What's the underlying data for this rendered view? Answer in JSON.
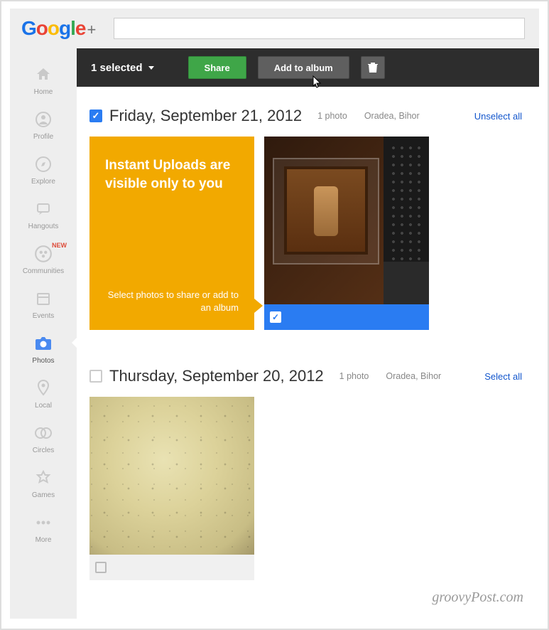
{
  "brand": {
    "name": "Google+",
    "plus": "+"
  },
  "sidebar": {
    "items": [
      {
        "label": "Home"
      },
      {
        "label": "Profile"
      },
      {
        "label": "Explore"
      },
      {
        "label": "Hangouts"
      },
      {
        "label": "Communities",
        "badge": "NEW"
      },
      {
        "label": "Events"
      },
      {
        "label": "Photos"
      },
      {
        "label": "Local"
      },
      {
        "label": "Circles"
      },
      {
        "label": "Games"
      },
      {
        "label": "More"
      }
    ]
  },
  "action_bar": {
    "selected_text": "1 selected",
    "share_label": "Share",
    "add_to_album_label": "Add to album",
    "delete_tooltip": "Delete"
  },
  "groups": [
    {
      "checked": true,
      "title": "Friday, September 21, 2012",
      "count_text": "1 photo",
      "location": "Oradea, Bihor",
      "select_action": "Unselect all",
      "info_tile": {
        "headline": "Instant Uploads are visible only to you",
        "subtext": "Select photos to share or add to an album"
      },
      "photo_selected": true
    },
    {
      "checked": false,
      "title": "Thursday, September 20, 2012",
      "count_text": "1 photo",
      "location": "Oradea, Bihor",
      "select_action": "Select all",
      "photo_selected": false
    }
  ],
  "watermark": "groovyPost.com"
}
